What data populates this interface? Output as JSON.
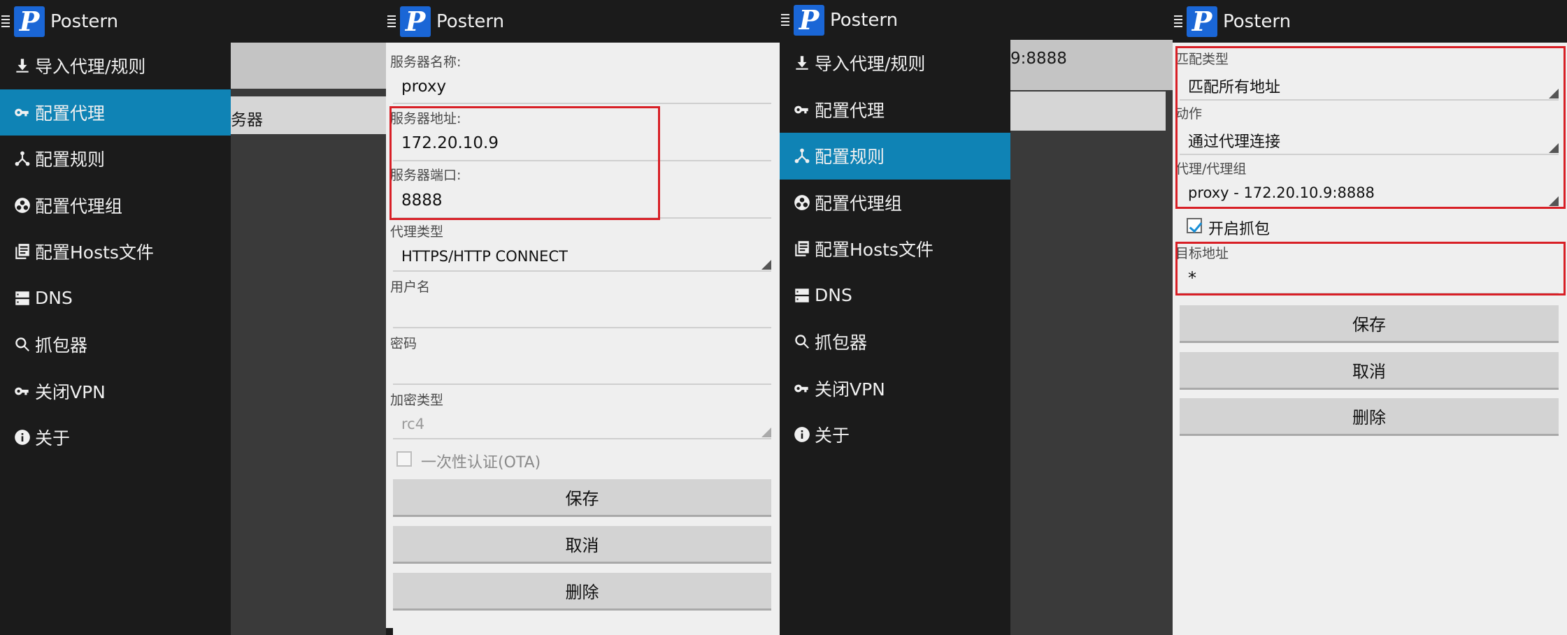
{
  "app": {
    "title": "Postern"
  },
  "drawer": {
    "items": [
      {
        "label": "导入代理/规则",
        "icon": "download-icon"
      },
      {
        "label": "配置代理",
        "icon": "key-icon"
      },
      {
        "label": "配置规则",
        "icon": "fork-icon"
      },
      {
        "label": "配置代理组",
        "icon": "group-icon"
      },
      {
        "label": "配置Hosts文件",
        "icon": "document-icon"
      },
      {
        "label": "DNS",
        "icon": "server-icon"
      },
      {
        "label": "抓包器",
        "icon": "search-icon"
      },
      {
        "label": "关闭VPN",
        "icon": "key-icon"
      },
      {
        "label": "关于",
        "icon": "info-icon"
      }
    ]
  },
  "panel1": {
    "active_index": 1,
    "background_text": "务器"
  },
  "panel2": {
    "server_name_label": "服务器名称:",
    "server_name_value": "proxy",
    "server_address_label": "服务器地址:",
    "server_address_value": "172.20.10.9",
    "server_port_label": "服务器端口:",
    "server_port_value": "8888",
    "proxy_type_label": "代理类型",
    "proxy_type_value": "HTTPS/HTTP CONNECT",
    "username_label": "用户名",
    "username_value": "",
    "password_label": "密码",
    "password_value": "",
    "encryption_label": "加密类型",
    "encryption_value": "rc4",
    "ota_label": "一次性认证(OTA)",
    "ota_checked": false,
    "save": "保存",
    "cancel": "取消",
    "delete": "删除"
  },
  "panel3": {
    "active_index": 2,
    "background_text": "9:8888"
  },
  "panel4": {
    "match_type_label": "匹配类型",
    "match_type_value": "匹配所有地址",
    "action_label": "动作",
    "action_value": "通过代理连接",
    "proxy_group_label": "代理/代理组",
    "proxy_group_value": "proxy - 172.20.10.9:8888",
    "capture_label": "开启抓包",
    "capture_checked": true,
    "target_label": "目标地址",
    "target_value": "*",
    "save": "保存",
    "cancel": "取消",
    "delete": "删除"
  },
  "colors": {
    "accent": "#0f83b5",
    "highlight": "#d81f26",
    "logo": "#1a66d6"
  }
}
